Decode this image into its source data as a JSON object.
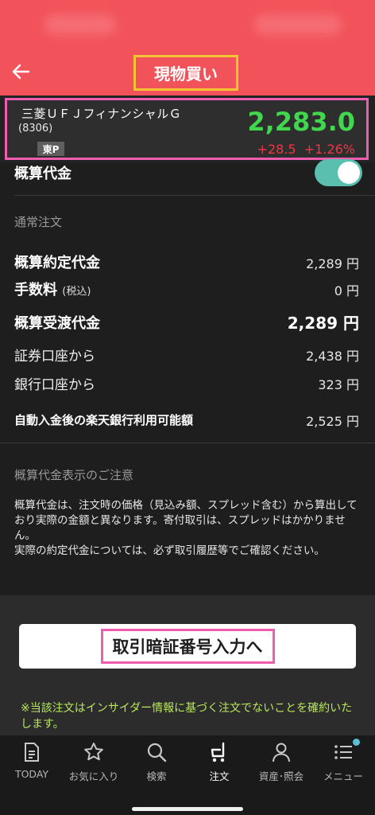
{
  "header": {
    "title": "現物買い",
    "back_icon": "back-arrow-icon"
  },
  "stock": {
    "name": "三菱ＵＦＪフィナンシャルＧ",
    "code": "(8306)",
    "market": "東P",
    "price": "2,283.0",
    "change": "+28.5",
    "change_pct": "+1.26%",
    "colors": {
      "price": "#40d64d",
      "change": "#f23542"
    }
  },
  "estimate_toggle": {
    "label": "概算代金",
    "on": true
  },
  "normal_order": {
    "section_label": "通常注文",
    "rows": [
      {
        "label": "概算約定代金",
        "value": "2,289 円"
      },
      {
        "label": "手数料",
        "sub": "(税込)",
        "value": "0 円"
      },
      {
        "label": "概算受渡代金",
        "value": "2,289 円"
      },
      {
        "label": "証券口座から",
        "value": "2,438 円"
      },
      {
        "label": "銀行口座から",
        "value": "323 円"
      },
      {
        "label": "自動入金後の楽天銀行利用可能額",
        "value": "2,525 円"
      }
    ]
  },
  "notes": {
    "title": "概算代金表示のご注意",
    "body_1": "概算代金は、注文時の価格（見込み額、スプレッド含む）から算出しており実際の金額と異なります。寄付取引は、スプレッドはかかりません。",
    "body_2": "実際の約定代金については、必ず取引履歴等でご確認ください。"
  },
  "action": {
    "pin_button": "取引暗証番号入力へ",
    "insider_note": "※当該注文はインサイダー情報に基づく注文でないことを確約いたします。"
  },
  "tabbar": {
    "items": [
      {
        "label": "TODAY",
        "icon": "document-icon"
      },
      {
        "label": "お気に入り",
        "icon": "star-icon"
      },
      {
        "label": "検索",
        "icon": "search-icon"
      },
      {
        "label": "注文",
        "icon": "cart-icon",
        "active": true
      },
      {
        "label": "資産･照会",
        "icon": "person-icon"
      },
      {
        "label": "メニュー",
        "icon": "menu-icon"
      }
    ]
  }
}
